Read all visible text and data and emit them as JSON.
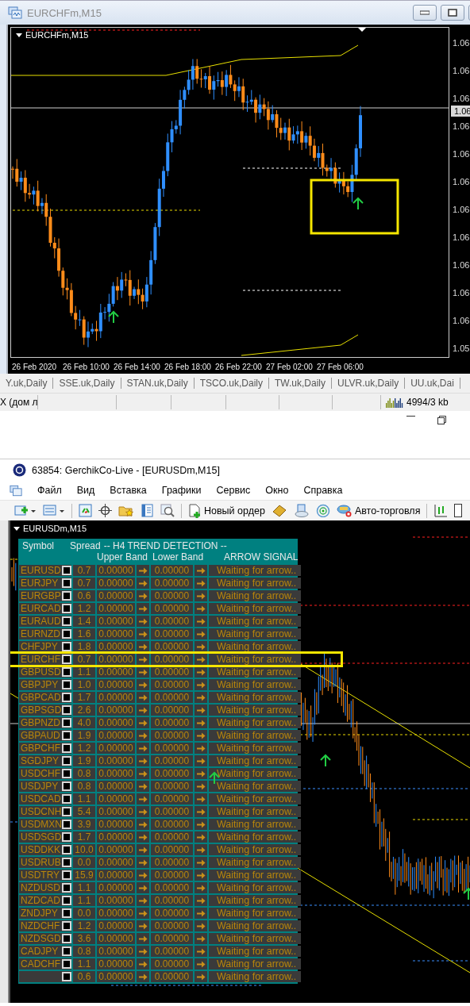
{
  "chart_window": {
    "title": "EURCHFm,M15",
    "chart_label": "EURCHFm,M15",
    "price_labels": [
      "1.06",
      "1.06",
      "1.06",
      "1.06",
      "1.06",
      "1.06",
      "1.06",
      "1.06",
      "1.06",
      "1.06",
      "1.06",
      "1.05"
    ],
    "current_price": "1.06",
    "time_labels": [
      "26 Feb 2020",
      "26 Feb 10:00",
      "26 Feb 14:00",
      "26 Feb 18:00",
      "26 Feb 22:00",
      "27 Feb 02:00",
      "27 Feb 06:00"
    ]
  },
  "chart_tabs": [
    "Y.uk,Daily",
    "SSE.uk,Daily",
    "STAN.uk,Daily",
    "TSCO.uk,Daily",
    "TW.uk,Daily",
    "ULVR.uk,Daily",
    "UU.uk,Dai"
  ],
  "status_bar": {
    "profile": "X (дом л",
    "traffic": "4994/3 kb"
  },
  "terminal": {
    "title": "63854: GerchikCo-Live - [EURUSDm,M15]",
    "menu": [
      "Файл",
      "Вид",
      "Вставка",
      "Графики",
      "Сервис",
      "Окно",
      "Справка"
    ],
    "toolbar": {
      "new_order": "Новый ордер",
      "auto_trading": "Авто-торговля"
    },
    "chart_label": "EURUSDm,M15",
    "table": {
      "headers": {
        "symbol": "Symbol",
        "spread": "Spread",
        "group": "-- H4  TREND DETECTION --",
        "upper": "Upper Band",
        "lower": "Lower Band",
        "signal": "ARROW SIGNAL"
      },
      "rows": [
        {
          "symbol": "EURUSD",
          "checked": false,
          "spread": "0.7",
          "upper": "0.00000",
          "lower": "0.00000",
          "signal": "Waiting for arrow.."
        },
        {
          "symbol": "EURJPY",
          "checked": false,
          "spread": "0.7",
          "upper": "0.00000",
          "lower": "0.00000",
          "signal": "Waiting for arrow.."
        },
        {
          "symbol": "EURGBP",
          "checked": false,
          "spread": "0.6",
          "upper": "0.00000",
          "lower": "0.00000",
          "signal": "Waiting for arrow.."
        },
        {
          "symbol": "EURCAD",
          "checked": false,
          "spread": "1.2",
          "upper": "0.00000",
          "lower": "0.00000",
          "signal": "Waiting for arrow.."
        },
        {
          "symbol": "EURAUD",
          "checked": false,
          "spread": "1.4",
          "upper": "0.00000",
          "lower": "0.00000",
          "signal": "Waiting for arrow.."
        },
        {
          "symbol": "EURNZD",
          "checked": false,
          "spread": "1.6",
          "upper": "0.00000",
          "lower": "0.00000",
          "signal": "Waiting for arrow.."
        },
        {
          "symbol": "CHFJPY",
          "checked": false,
          "spread": "1.8",
          "upper": "0.00000",
          "lower": "0.00000",
          "signal": "Waiting for arrow.."
        },
        {
          "symbol": "EURCHF",
          "checked": false,
          "spread": "0.7",
          "upper": "0.00000",
          "lower": "0.00000",
          "signal": "Waiting for arrow.."
        },
        {
          "symbol": "GBPUSD",
          "checked": false,
          "spread": "1.1",
          "upper": "0.00000",
          "lower": "0.00000",
          "signal": "Waiting for arrow.."
        },
        {
          "symbol": "GBPJPY",
          "checked": false,
          "spread": "1.0",
          "upper": "0.00000",
          "lower": "0.00000",
          "signal": "Waiting for arrow.."
        },
        {
          "symbol": "GBPCAD",
          "checked": false,
          "spread": "1.7",
          "upper": "0.00000",
          "lower": "0.00000",
          "signal": "Waiting for arrow.."
        },
        {
          "symbol": "GBPSGD",
          "checked": false,
          "spread": "2.6",
          "upper": "0.00000",
          "lower": "0.00000",
          "signal": "Waiting for arrow.."
        },
        {
          "symbol": "GBPNZD",
          "checked": false,
          "spread": "4.0",
          "upper": "0.00000",
          "lower": "0.00000",
          "signal": "Waiting for arrow.."
        },
        {
          "symbol": "GBPAUD",
          "checked": false,
          "spread": "1.9",
          "upper": "0.00000",
          "lower": "0.00000",
          "signal": "Waiting for arrow.."
        },
        {
          "symbol": "GBPCHF",
          "checked": false,
          "spread": "1.2",
          "upper": "0.00000",
          "lower": "0.00000",
          "signal": "Waiting for arrow.."
        },
        {
          "symbol": "SGDJPY",
          "checked": false,
          "spread": "1.9",
          "upper": "0.00000",
          "lower": "0.00000",
          "signal": "Waiting for arrow.."
        },
        {
          "symbol": "USDCHF",
          "checked": false,
          "spread": "0.8",
          "upper": "0.00000",
          "lower": "0.00000",
          "signal": "Waiting for arrow.."
        },
        {
          "symbol": "USDJPY",
          "checked": false,
          "spread": "0.8",
          "upper": "0.00000",
          "lower": "0.00000",
          "signal": "Waiting for arrow.."
        },
        {
          "symbol": "USDCAD",
          "checked": false,
          "spread": "1.1",
          "upper": "0.00000",
          "lower": "0.00000",
          "signal": "Waiting for arrow.."
        },
        {
          "symbol": "USDCNH",
          "checked": false,
          "spread": "5.4",
          "upper": "0.00000",
          "lower": "0.00000",
          "signal": "Waiting for arrow.."
        },
        {
          "symbol": "USDMXN",
          "checked": false,
          "spread": "3.9",
          "upper": "0.00000",
          "lower": "0.00000",
          "signal": "Waiting for arrow.."
        },
        {
          "symbol": "USDSGD",
          "checked": false,
          "spread": "1.7",
          "upper": "0.00000",
          "lower": "0.00000",
          "signal": "Waiting for arrow.."
        },
        {
          "symbol": "USDDKK",
          "checked": false,
          "spread": "10.0",
          "upper": "0.00000",
          "lower": "0.00000",
          "signal": "Waiting for arrow.."
        },
        {
          "symbol": "USDRUB",
          "checked": false,
          "spread": "0.0",
          "upper": "0.00000",
          "lower": "0.00000",
          "signal": "Waiting for arrow.."
        },
        {
          "symbol": "USDTRY",
          "checked": false,
          "spread": "15.9",
          "upper": "0.00000",
          "lower": "0.00000",
          "signal": "Waiting for arrow.."
        },
        {
          "symbol": "NZDUSD",
          "checked": false,
          "spread": "1.1",
          "upper": "0.00000",
          "lower": "0.00000",
          "signal": "Waiting for arrow.."
        },
        {
          "symbol": "NZDCAD",
          "checked": false,
          "spread": "1.1",
          "upper": "0.00000",
          "lower": "0.00000",
          "signal": "Waiting for arrow.."
        },
        {
          "symbol": "ZNDJPY",
          "checked": false,
          "spread": "0.0",
          "upper": "0.00000",
          "lower": "0.00000",
          "signal": "Waiting for arrow.."
        },
        {
          "symbol": "NZDCHF",
          "checked": false,
          "spread": "1.2",
          "upper": "0.00000",
          "lower": "0.00000",
          "signal": "Waiting for arrow.."
        },
        {
          "symbol": "NZDSGD",
          "checked": false,
          "spread": "3.6",
          "upper": "0.00000",
          "lower": "0.00000",
          "signal": "Waiting for arrow.."
        },
        {
          "symbol": "CADJPY",
          "checked": false,
          "spread": "0.8",
          "upper": "0.00000",
          "lower": "0.00000",
          "signal": "Waiting for arrow.."
        },
        {
          "symbol": "CADCHF",
          "checked": false,
          "spread": "1.1",
          "upper": "0.00000",
          "lower": "0.00000",
          "signal": "Waiting for arrow.."
        },
        {
          "checked": false,
          "spread": "0.6",
          "upper": "0.00000",
          "lower": "0.00000",
          "signal": "Waiting for arrow.."
        }
      ]
    }
  }
}
